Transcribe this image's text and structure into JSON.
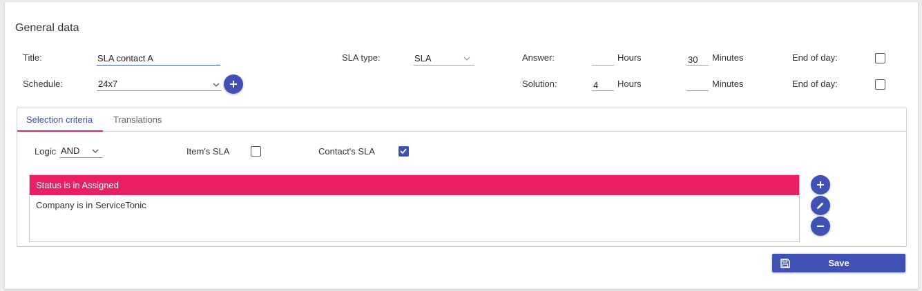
{
  "section_title": "General data",
  "fields": {
    "title_label": "Title:",
    "title_value": "SLA contact A",
    "schedule_label": "Schedule:",
    "schedule_value": "24x7",
    "sla_type_label": "SLA type:",
    "sla_type_value": "SLA",
    "answer_label": "Answer:",
    "answer_hours": "",
    "answer_minutes": "30",
    "solution_label": "Solution:",
    "solution_hours": "4",
    "solution_minutes": "",
    "hours_label": "Hours",
    "minutes_label": "Minutes",
    "end_of_day_label": "End of day:",
    "answer_end_of_day": false,
    "solution_end_of_day": false
  },
  "tabs": [
    {
      "label": "Selection criteria",
      "active": true
    },
    {
      "label": "Translations",
      "active": false
    }
  ],
  "criteria": {
    "logic_label": "Logic",
    "logic_value": "AND",
    "items_sla_label": "Item's SLA",
    "items_sla_checked": false,
    "contacts_sla_label": "Contact's SLA",
    "contacts_sla_checked": true,
    "rows": [
      {
        "text": "Status is in Assigned",
        "selected": true
      },
      {
        "text": "Company is in ServiceTonic",
        "selected": false
      }
    ]
  },
  "actions": {
    "save_label": "Save"
  },
  "colors": {
    "accent": "#3f51b5",
    "selected_row": "#e91e63"
  },
  "icons": {
    "schedule_add": "plus-icon",
    "criteria_add": "plus-icon",
    "criteria_edit": "pencil-icon",
    "criteria_remove": "minus-icon",
    "save": "floppy-disk-icon"
  }
}
